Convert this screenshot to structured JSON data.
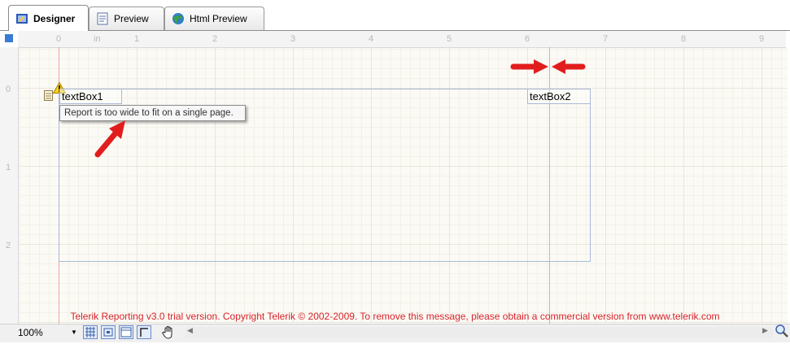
{
  "tabs": [
    {
      "label": "Designer",
      "icon": "designer-icon",
      "active": true
    },
    {
      "label": "Preview",
      "icon": "preview-icon",
      "active": false
    },
    {
      "label": "Html Preview",
      "icon": "globe-icon",
      "active": false
    }
  ],
  "ruler": {
    "unit": "in",
    "horizontal": [
      "0",
      "1",
      "2",
      "3",
      "4",
      "5",
      "6",
      "7",
      "8",
      "9"
    ],
    "vertical": [
      "0",
      "1",
      "2"
    ]
  },
  "report": {
    "textbox1": "textBox1",
    "textbox2": "textBox2",
    "tooltip": "Report is too wide to fit on a single page.",
    "trial_notice": "Telerik Reporting v3.0 trial version. Copyright Telerik © 2002-2009. To remove this message, please obtain a commercial version from www.telerik.com"
  },
  "statusbar": {
    "zoom": "100%"
  },
  "colors": {
    "annotation_arrow": "#e21d1d",
    "trial_text": "#d8232a",
    "margin_line": "#f2a3a3"
  }
}
